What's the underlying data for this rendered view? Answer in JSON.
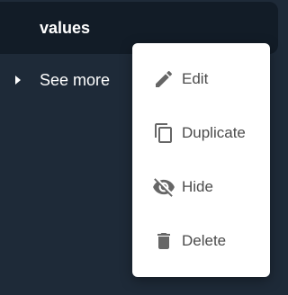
{
  "header": {
    "title": "values"
  },
  "see_more": {
    "label": "See more",
    "icon": "caret-right-icon"
  },
  "context_menu": {
    "items": [
      {
        "label": "Edit",
        "icon": "pencil-icon"
      },
      {
        "label": "Duplicate",
        "icon": "duplicate-icon"
      },
      {
        "label": "Hide",
        "icon": "eye-off-icon"
      },
      {
        "label": "Delete",
        "icon": "trash-icon"
      }
    ]
  },
  "colors": {
    "background": "#1e2a38",
    "header_background": "#121c27",
    "menu_background": "#ffffff",
    "menu_text": "#4b4b4b",
    "menu_icon": "#666666"
  }
}
